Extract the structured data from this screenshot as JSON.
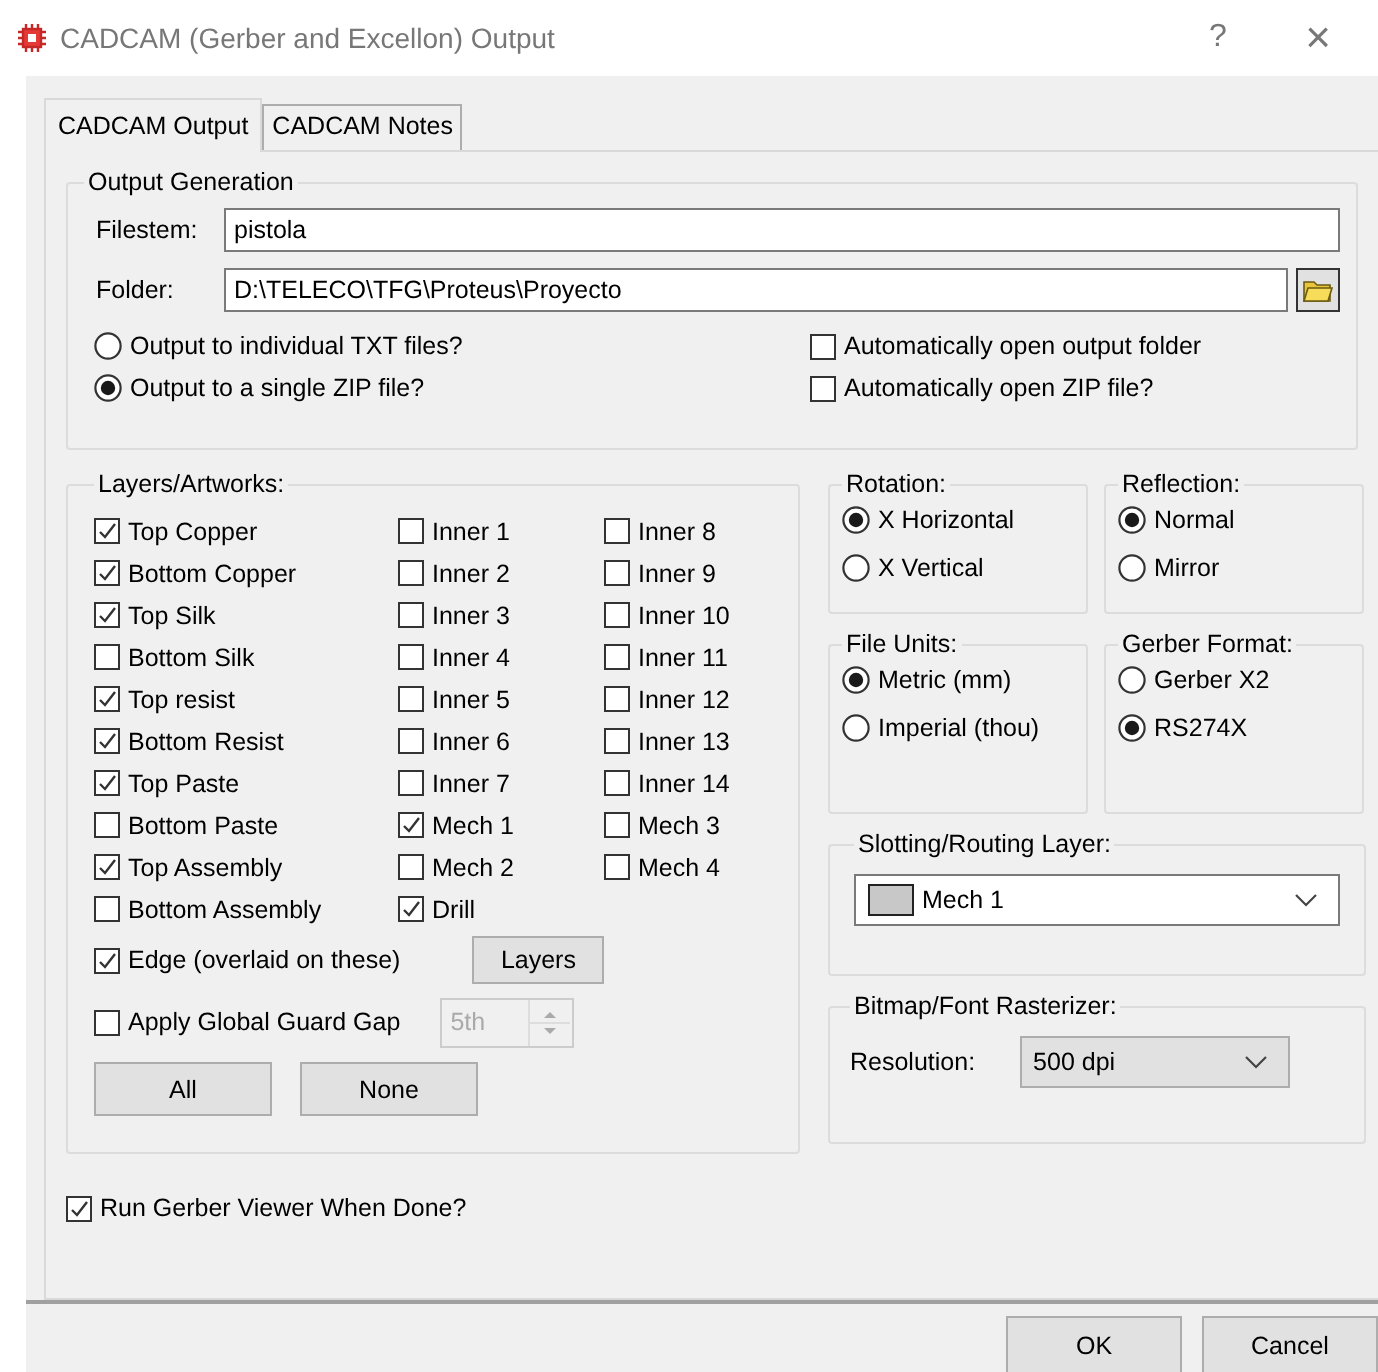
{
  "window": {
    "title": "CADCAM (Gerber and Excellon) Output",
    "help": "?",
    "close": "×"
  },
  "tabs": [
    {
      "label": "CADCAM Output",
      "selected": true
    },
    {
      "label": "CADCAM Notes",
      "selected": false
    }
  ],
  "output_generation": {
    "title": "Output Generation",
    "fields": [
      {
        "label": "Filestem:",
        "value": "pistola",
        "browse": false
      },
      {
        "label": "Folder:",
        "value": "D:\\TELECO\\TFG\\Proteus\\Proyecto",
        "browse": true
      }
    ],
    "output_mode": [
      {
        "label": "Output to individual TXT files?",
        "selected": false
      },
      {
        "label": "Output to a single ZIP file?",
        "selected": true
      }
    ],
    "auto_open": [
      {
        "label": "Automatically open output folder",
        "checked": false
      },
      {
        "label": "Automatically open ZIP file?",
        "checked": false
      }
    ]
  },
  "layers": {
    "title": "Layers/Artworks:",
    "columns": [
      [
        {
          "label": "Top Copper",
          "checked": true
        },
        {
          "label": "Bottom Copper",
          "checked": true
        },
        {
          "label": "Top Silk",
          "checked": true
        },
        {
          "label": "Bottom Silk",
          "checked": false
        },
        {
          "label": "Top resist",
          "checked": true
        },
        {
          "label": "Bottom Resist",
          "checked": true
        },
        {
          "label": "Top Paste",
          "checked": true
        },
        {
          "label": "Bottom Paste",
          "checked": false
        },
        {
          "label": "Top Assembly",
          "checked": true
        },
        {
          "label": "Bottom Assembly",
          "checked": false
        }
      ],
      [
        {
          "label": "Inner 1",
          "checked": false
        },
        {
          "label": "Inner 2",
          "checked": false
        },
        {
          "label": "Inner 3",
          "checked": false
        },
        {
          "label": "Inner 4",
          "checked": false
        },
        {
          "label": "Inner 5",
          "checked": false
        },
        {
          "label": "Inner 6",
          "checked": false
        },
        {
          "label": "Inner 7",
          "checked": false
        },
        {
          "label": "Mech 1",
          "checked": true
        },
        {
          "label": "Mech 2",
          "checked": false
        },
        {
          "label": "Drill",
          "checked": true
        }
      ],
      [
        {
          "label": "Inner 8",
          "checked": false
        },
        {
          "label": "Inner 9",
          "checked": false
        },
        {
          "label": "Inner 10",
          "checked": false
        },
        {
          "label": "Inner 11",
          "checked": false
        },
        {
          "label": "Inner 12",
          "checked": false
        },
        {
          "label": "Inner 13",
          "checked": false
        },
        {
          "label": "Inner 14",
          "checked": false
        },
        {
          "label": "Mech 3",
          "checked": false
        },
        {
          "label": "Mech 4",
          "checked": false
        }
      ]
    ],
    "edge": {
      "label": "Edge (overlaid on these)",
      "checked": true
    },
    "layers_button": "Layers",
    "guard_gap": {
      "label": "Apply Global Guard Gap",
      "checked": false
    },
    "guard_gap_spinner": {
      "value": "5th",
      "disabled": true
    },
    "buttons": [
      "All",
      "None"
    ]
  },
  "rotation": {
    "title": "Rotation:",
    "options": [
      {
        "label": "X Horizontal",
        "selected": true
      },
      {
        "label": "X Vertical",
        "selected": false
      }
    ]
  },
  "reflection": {
    "title": "Reflection:",
    "options": [
      {
        "label": "Normal",
        "selected": true
      },
      {
        "label": "Mirror",
        "selected": false
      }
    ]
  },
  "file_units": {
    "title": "File Units:",
    "options": [
      {
        "label": "Metric (mm)",
        "selected": true
      },
      {
        "label": "Imperial (thou)",
        "selected": false
      }
    ]
  },
  "gerber_format": {
    "title": "Gerber Format:",
    "options": [
      {
        "label": "Gerber X2",
        "selected": false
      },
      {
        "label": "RS274X",
        "selected": true
      }
    ]
  },
  "slotting": {
    "title": "Slotting/Routing Layer:",
    "value": "Mech 1"
  },
  "rasterizer": {
    "title": "Bitmap/Font Rasterizer:",
    "label": "Resolution:",
    "value": "500 dpi"
  },
  "run_viewer": {
    "label": "Run Gerber Viewer When Done?",
    "checked": true
  },
  "buttons": [
    "OK",
    "Cancel"
  ]
}
